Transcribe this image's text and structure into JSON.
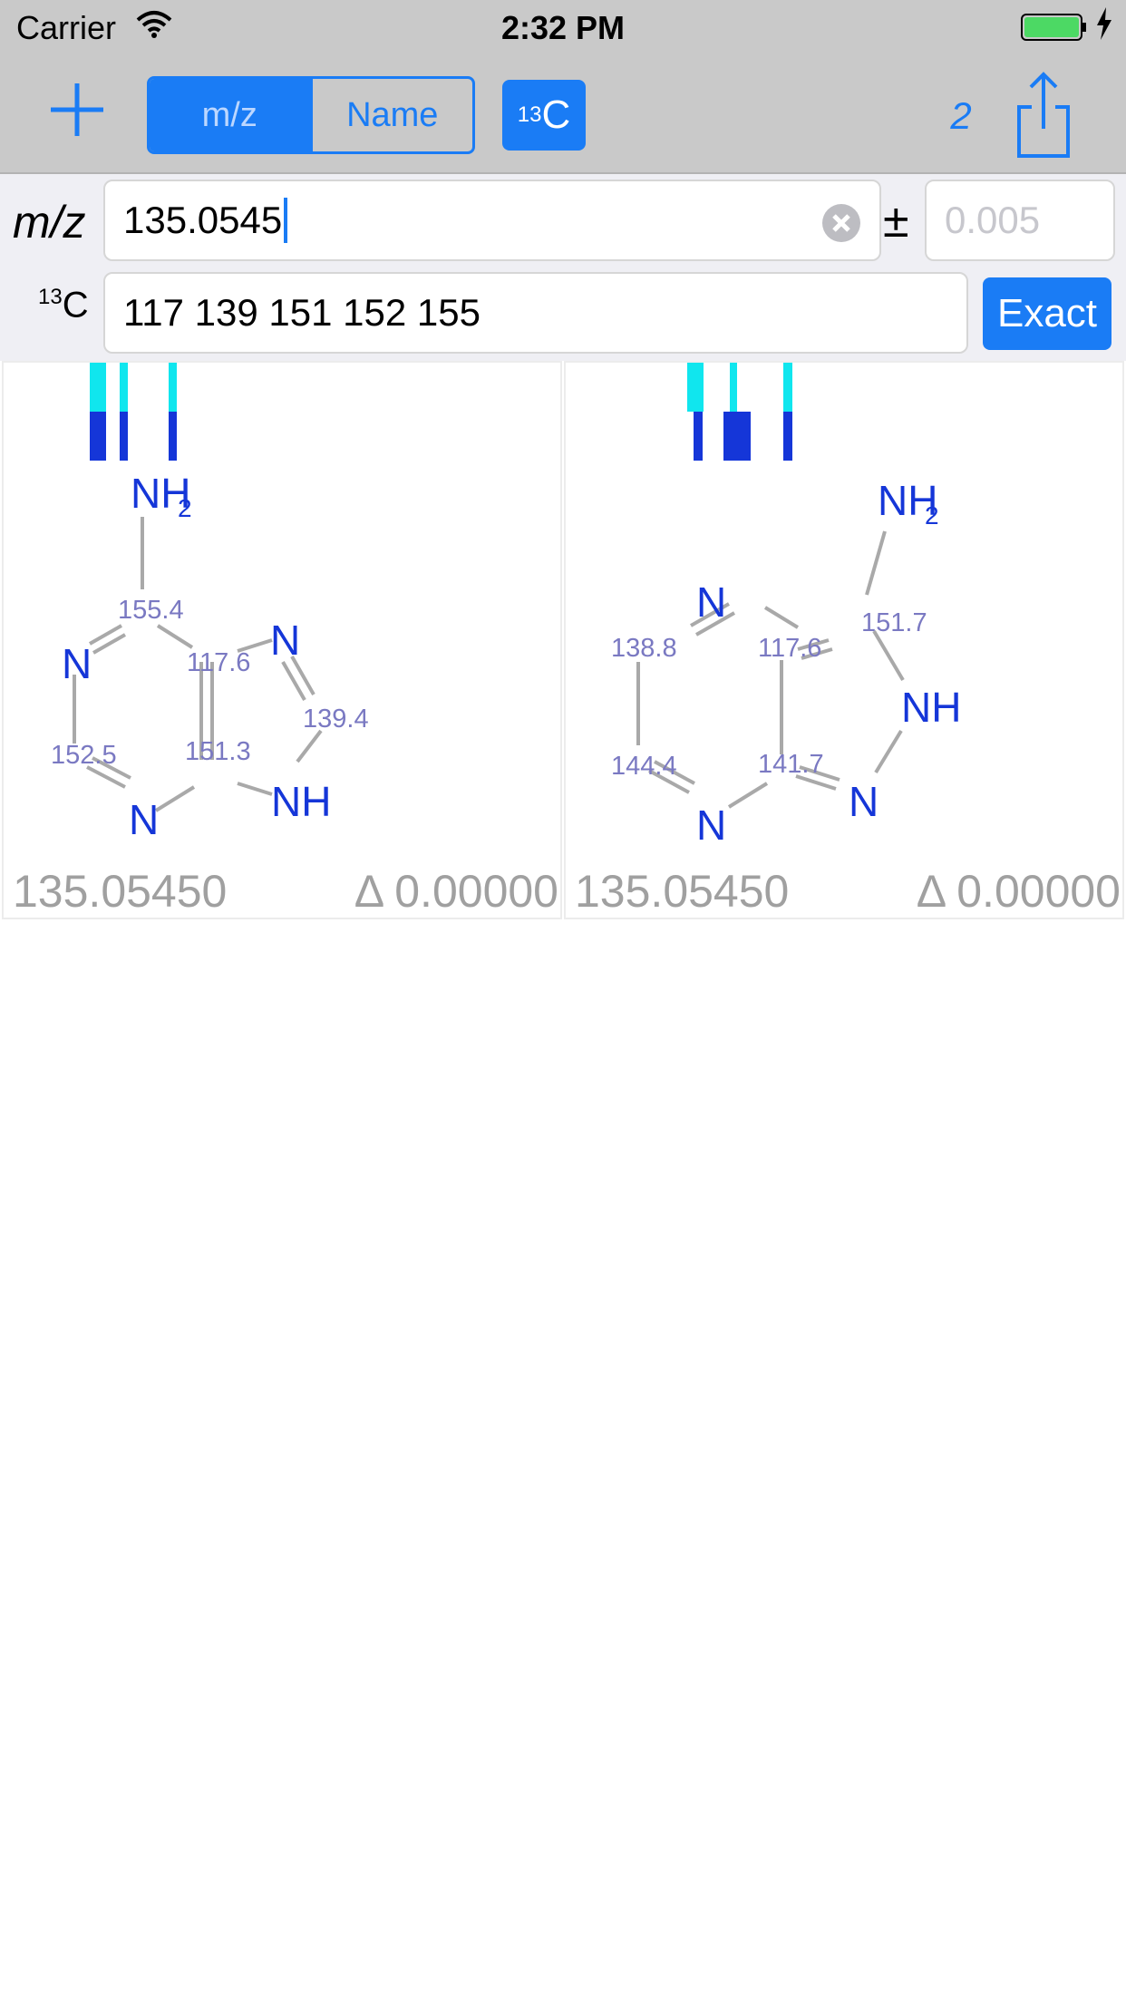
{
  "status": {
    "carrier": "Carrier",
    "time": "2:32 PM"
  },
  "toolbar": {
    "segment_mz": "m/z",
    "segment_name": "Name",
    "c13_sup": "13",
    "c13_letter": "C",
    "count": "2",
    "selected_segment": "m/z"
  },
  "search": {
    "mz_label": "m/z",
    "mz_value": "135.0545",
    "pm": "±",
    "tolerance_placeholder": "0.005",
    "c13_sup": "13",
    "c13_letter": "C",
    "c13_value": "117 139 151 152 155",
    "exact_label": "Exact"
  },
  "results": [
    {
      "atoms": {
        "nh2": "NH",
        "nh2_sub": "2",
        "n1": "N",
        "n3": "N",
        "n7": "N",
        "nh9": "NH"
      },
      "shifts": {
        "s1": "155.4",
        "s2": "117.6",
        "s3": "139.4",
        "s4": "152.5",
        "s5": "151.3"
      },
      "mass": "135.05450",
      "delta": "Δ 0.00000"
    },
    {
      "atoms": {
        "nh2": "NH",
        "nh2_sub": "2",
        "n1": "N",
        "n2": "N",
        "nh": "NH",
        "n3": "N"
      },
      "shifts": {
        "s1": "151.7",
        "s2": "138.8",
        "s3": "117.6",
        "s4": "144.4",
        "s5": "141.7"
      },
      "mass": "135.05450",
      "delta": "Δ 0.00000"
    }
  ],
  "colors": {
    "accent": "#1a7cf5",
    "atom": "#1536d8",
    "shift": "#7a79c2",
    "bar_cyan": "#10e6ee",
    "bar_blue": "#1536d8"
  }
}
